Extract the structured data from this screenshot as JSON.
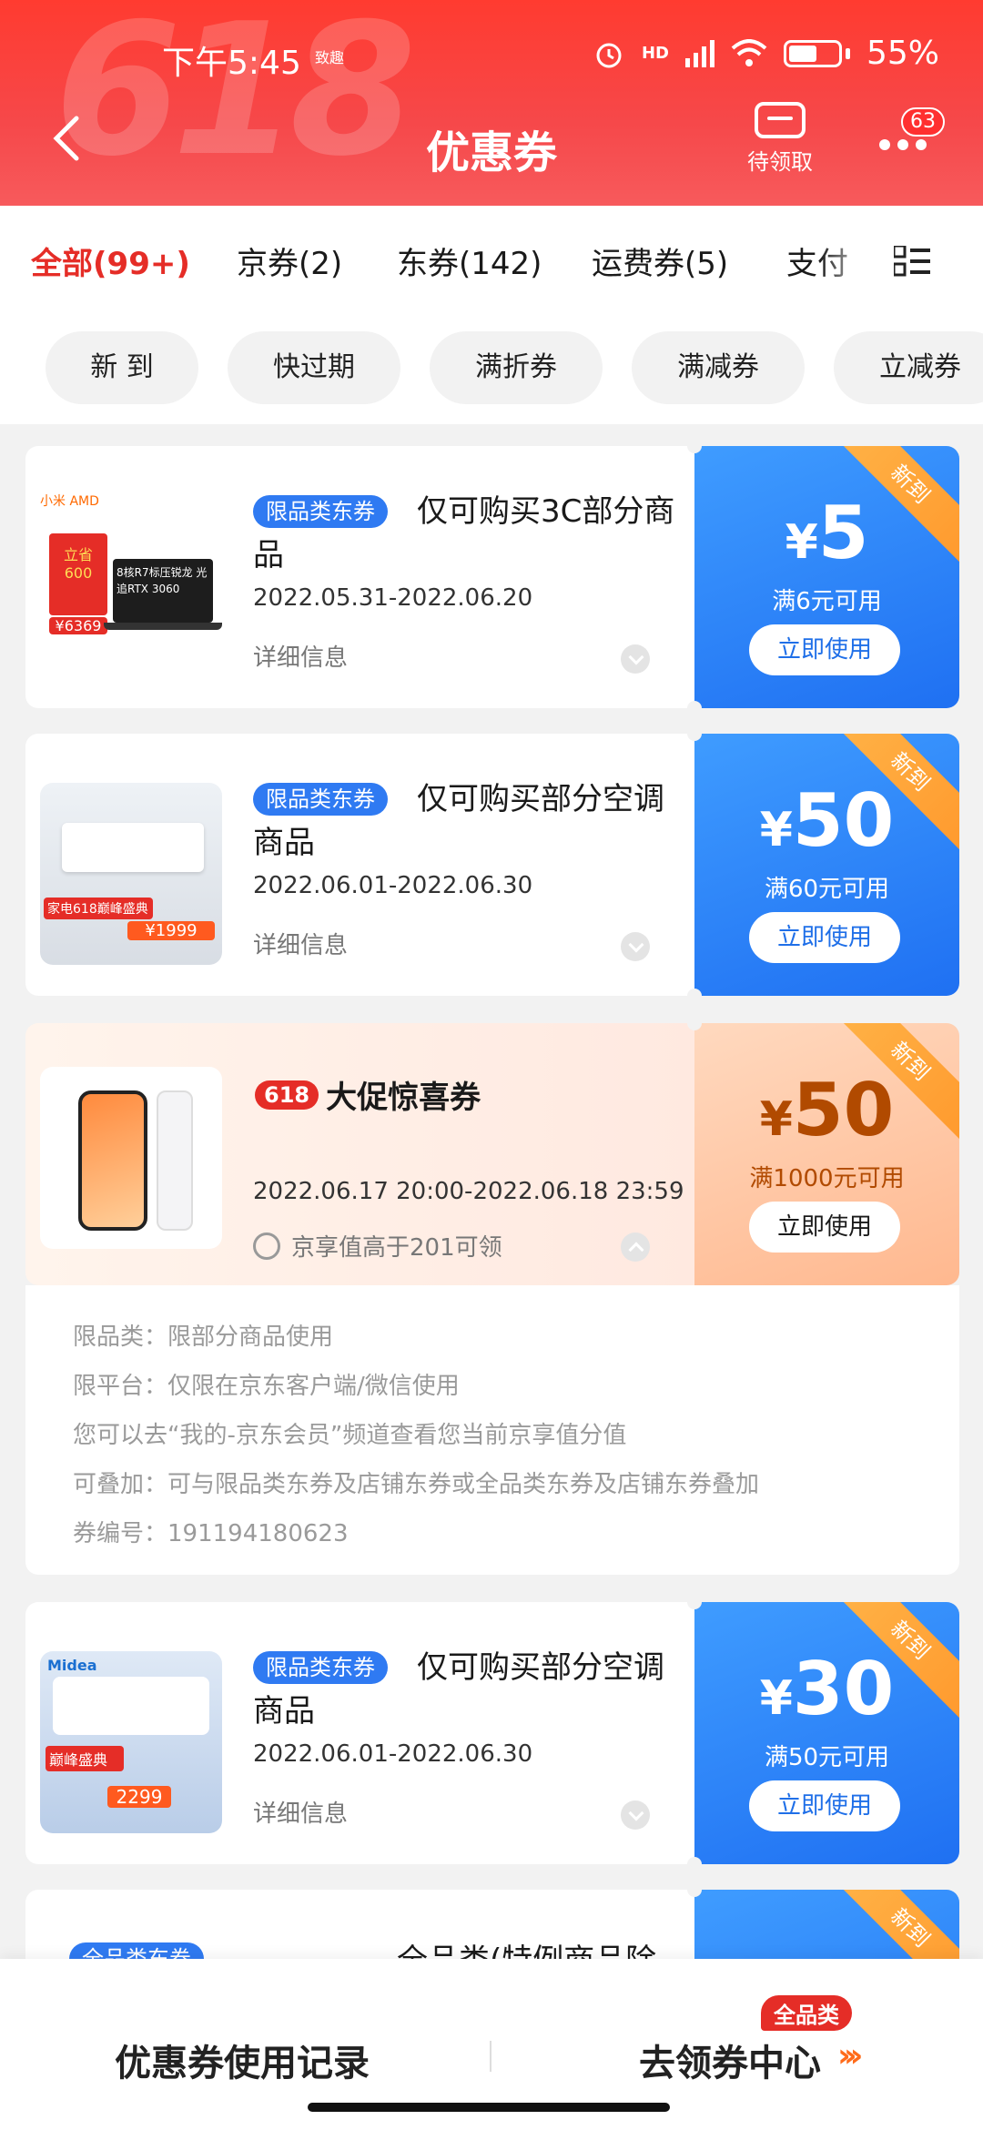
{
  "status_bar": {
    "time": "下午5:45",
    "extra": "致趣",
    "network": "HD",
    "battery": "55%"
  },
  "header": {
    "watermark": "618",
    "title": "优惠券",
    "pending_label": "待领取",
    "more_badge": "63"
  },
  "tabs": [
    {
      "label": "全部(99+)",
      "active": true
    },
    {
      "label": "京券(2)"
    },
    {
      "label": "东券(142)"
    },
    {
      "label": "运费券(5)"
    },
    {
      "label": "支付"
    }
  ],
  "chips": [
    "新 到",
    "快过期",
    "满折券",
    "满减券",
    "立减券"
  ],
  "coupons": [
    {
      "tag": "限品类东券",
      "title": "仅可购买3C部分商品",
      "dates": "2022.05.31-2022.06.20",
      "detail": "详细信息",
      "amount": "5",
      "currency": "¥",
      "condition": "满6元可用",
      "button": "立即使用",
      "ribbon": "新到",
      "thumb_caption": "8核R7标压锐龙 光追RTX 3060",
      "thumb_brand": "小米 AMD",
      "thumb_price": "¥6369",
      "thumb_badge": "立省 600"
    },
    {
      "tag": "限品类东券",
      "title": "仅可购买部分空调商品",
      "dates": "2022.06.01-2022.06.30",
      "detail": "详细信息",
      "amount": "50",
      "currency": "¥",
      "condition": "满60元可用",
      "button": "立即使用",
      "ribbon": "新到",
      "thumb_price": "¥1999",
      "thumb_banner": "家电618巅峰盛典"
    },
    {
      "brand_badge": "618",
      "brand_title": "大促惊喜券",
      "dates": "2022.06.17 20:00-2022.06.18 23:59",
      "member_text": "京享值高于201可领",
      "amount": "50",
      "currency": "¥",
      "condition": "满1000元可用",
      "button": "立即使用",
      "ribbon": "新到"
    },
    {
      "tag": "限品类东券",
      "title": "仅可购买部分空调商品",
      "dates": "2022.06.01-2022.06.30",
      "detail": "详细信息",
      "amount": "30",
      "currency": "¥",
      "condition": "满50元可用",
      "button": "立即使用",
      "ribbon": "新到",
      "thumb_brand": "Midea",
      "thumb_price": "2299",
      "thumb_banner": "巅峰盛典"
    },
    {
      "tag": "全品类东券",
      "title": "全品类(特例商品除外)",
      "ribbon": "新到"
    }
  ],
  "promo_details": [
    "限品类：限部分商品使用",
    "限平台：仅限在京东客户端/微信使用",
    "您可以去“我的-京东会员”频道查看您当前京享值分值",
    "可叠加：可与限品类东券及店铺东券或全品类东券及店铺东券叠加",
    "券编号：191194180623"
  ],
  "bottom": {
    "history": "优惠券使用记录",
    "center": "去领券中心",
    "badge": "全品类",
    "arrows": "›››"
  },
  "colors": {
    "brand_red": "#e52d27",
    "coupon_blue": "#1f70f2",
    "ribbon_orange": "#ff9a2e"
  }
}
